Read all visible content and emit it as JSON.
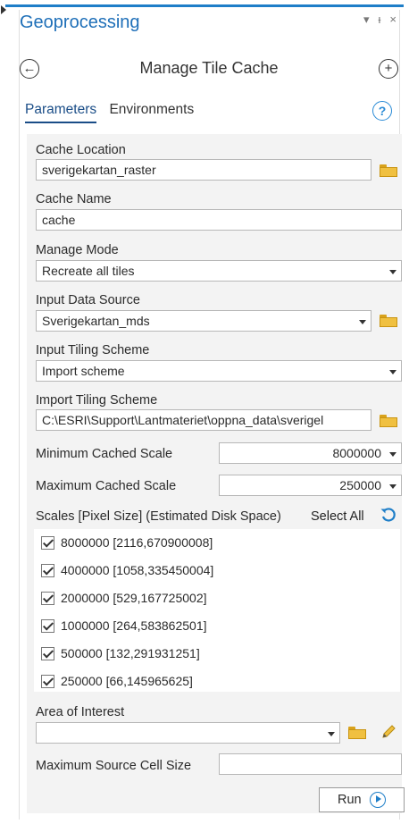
{
  "pane": {
    "title": "Geoprocessing",
    "ctrl_pin": "▾",
    "ctrl_autohide": "ᵼ",
    "ctrl_close": "×"
  },
  "nav": {
    "back_glyph": "←",
    "tool_title": "Manage Tile Cache",
    "add_glyph": "+"
  },
  "tabs": [
    {
      "label": "Parameters",
      "active": true
    },
    {
      "label": "Environments",
      "active": false
    }
  ],
  "help_glyph": "?",
  "params": {
    "cache_location": {
      "label": "Cache Location",
      "value": "sverigekartan_raster"
    },
    "cache_name": {
      "label": "Cache Name",
      "value": "cache"
    },
    "manage_mode": {
      "label": "Manage Mode",
      "value": "Recreate all tiles"
    },
    "input_data_source": {
      "label": "Input Data Source",
      "value": "Sverigekartan_mds"
    },
    "input_tiling_scheme": {
      "label": "Input Tiling Scheme",
      "value": "Import scheme"
    },
    "import_tiling_scheme": {
      "label": "Import Tiling Scheme",
      "value": "C:\\ESRI\\Support\\Lantmateriet\\oppna_data\\sverigel"
    },
    "min_cached_scale": {
      "label": "Minimum Cached Scale",
      "value": "8000000"
    },
    "max_cached_scale": {
      "label": "Maximum Cached Scale",
      "value": "250000"
    },
    "scales": {
      "label": "Scales [Pixel Size] (Estimated Disk Space)",
      "select_all": "Select All",
      "items": [
        {
          "text": "8000000 [2116,670900008]",
          "checked": true
        },
        {
          "text": "4000000 [1058,335450004]",
          "checked": true
        },
        {
          "text": "2000000 [529,167725002]",
          "checked": true
        },
        {
          "text": "1000000 [264,583862501]",
          "checked": true
        },
        {
          "text": "500000 [132,291931251]",
          "checked": true
        },
        {
          "text": "250000 [66,145965625]",
          "checked": true
        }
      ]
    },
    "area_of_interest": {
      "label": "Area of Interest",
      "value": ""
    },
    "max_source_cell_size": {
      "label": "Maximum Source Cell Size",
      "value": ""
    }
  },
  "run_label": "Run",
  "colors": {
    "accent": "#1e7ec8",
    "folder": "#f0c040",
    "panel_bg": "#f3f3f3"
  }
}
